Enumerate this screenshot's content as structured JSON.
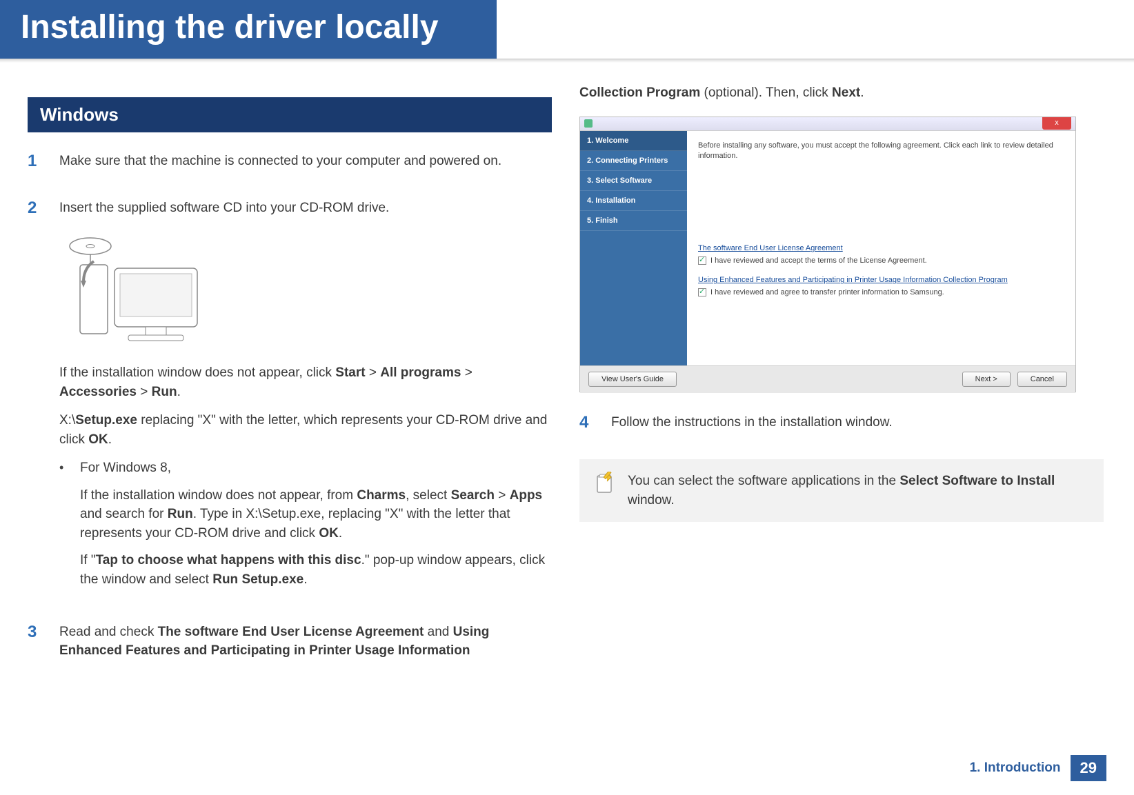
{
  "page": {
    "title": "Installing the driver locally",
    "chapter": "1.  Introduction",
    "page_number": "29"
  },
  "section": {
    "heading": "Windows"
  },
  "steps": {
    "s1": {
      "num": "1",
      "text": "Make sure that the machine is connected to your computer and powered on."
    },
    "s2": {
      "num": "2",
      "text": "Insert the supplied software CD into your CD-ROM drive.",
      "after1_a": "If the installation window does not appear, click ",
      "after1_b": "Start",
      "after1_c": " > ",
      "after1_d": "All programs",
      "after1_e": " > ",
      "after1_f": "Accessories",
      "after1_g": " > ",
      "after1_h": "Run",
      "after1_i": ".",
      "after2_a": " X:\\",
      "after2_b": "Setup.exe",
      "after2_c": " replacing \"X\" with the letter, which represents your CD-ROM drive and click ",
      "after2_d": "OK",
      "after2_e": ".",
      "bullet_lead": "For Windows 8,",
      "bullet_p1_a": "If the installation window does not appear, from ",
      "bullet_p1_b": "Charms",
      "bullet_p1_c": ", select ",
      "bullet_p1_d": "Search",
      "bullet_p1_e": " > ",
      "bullet_p1_f": "Apps",
      "bullet_p1_g": " and search for ",
      "bullet_p1_h": "Run",
      "bullet_p1_i": ". Type in X:\\Setup.exe, replacing \"X\" with the letter that represents your CD-ROM drive and click ",
      "bullet_p1_j": "OK",
      "bullet_p1_k": ".",
      "bullet_p2_a": "If \"",
      "bullet_p2_b": "Tap to choose what happens with this disc",
      "bullet_p2_c": ".\" pop-up window appears, click the window and select ",
      "bullet_p2_d": "Run Setup.exe",
      "bullet_p2_e": "."
    },
    "s3": {
      "num": "3",
      "text_a": "Read and check ",
      "text_b": "The software End User License Agreement",
      "text_c": " and ",
      "text_d": "Using Enhanced Features and Participating in Printer Usage Information ",
      "cont_a": "Collection Program",
      "cont_b": " (optional). Then, click ",
      "cont_c": "Next",
      "cont_d": "."
    },
    "s4": {
      "num": "4",
      "text": "Follow the instructions in the installation window."
    }
  },
  "installer": {
    "sidebar": {
      "s1": "1. Welcome",
      "s2": "2. Connecting Printers",
      "s3": "3. Select Software",
      "s4": "4. Installation",
      "s5": "5. Finish"
    },
    "intro": "Before installing any software, you must accept the following agreement. Click each link to review detailed information.",
    "eula_link": "The software End User License Agreement",
    "chk1": "I have reviewed and accept the terms of the License Agreement.",
    "enh_link": "Using Enhanced Features and Participating in Printer Usage Information Collection Program",
    "chk2": "I have reviewed and agree to transfer printer information to Samsung.",
    "btn_guide": "View User's Guide",
    "btn_next": "Next >",
    "btn_cancel": "Cancel",
    "close": "x"
  },
  "note": {
    "text_a": "You can select the software applications in the ",
    "text_b": "Select Software to Install",
    "text_c": " window."
  }
}
